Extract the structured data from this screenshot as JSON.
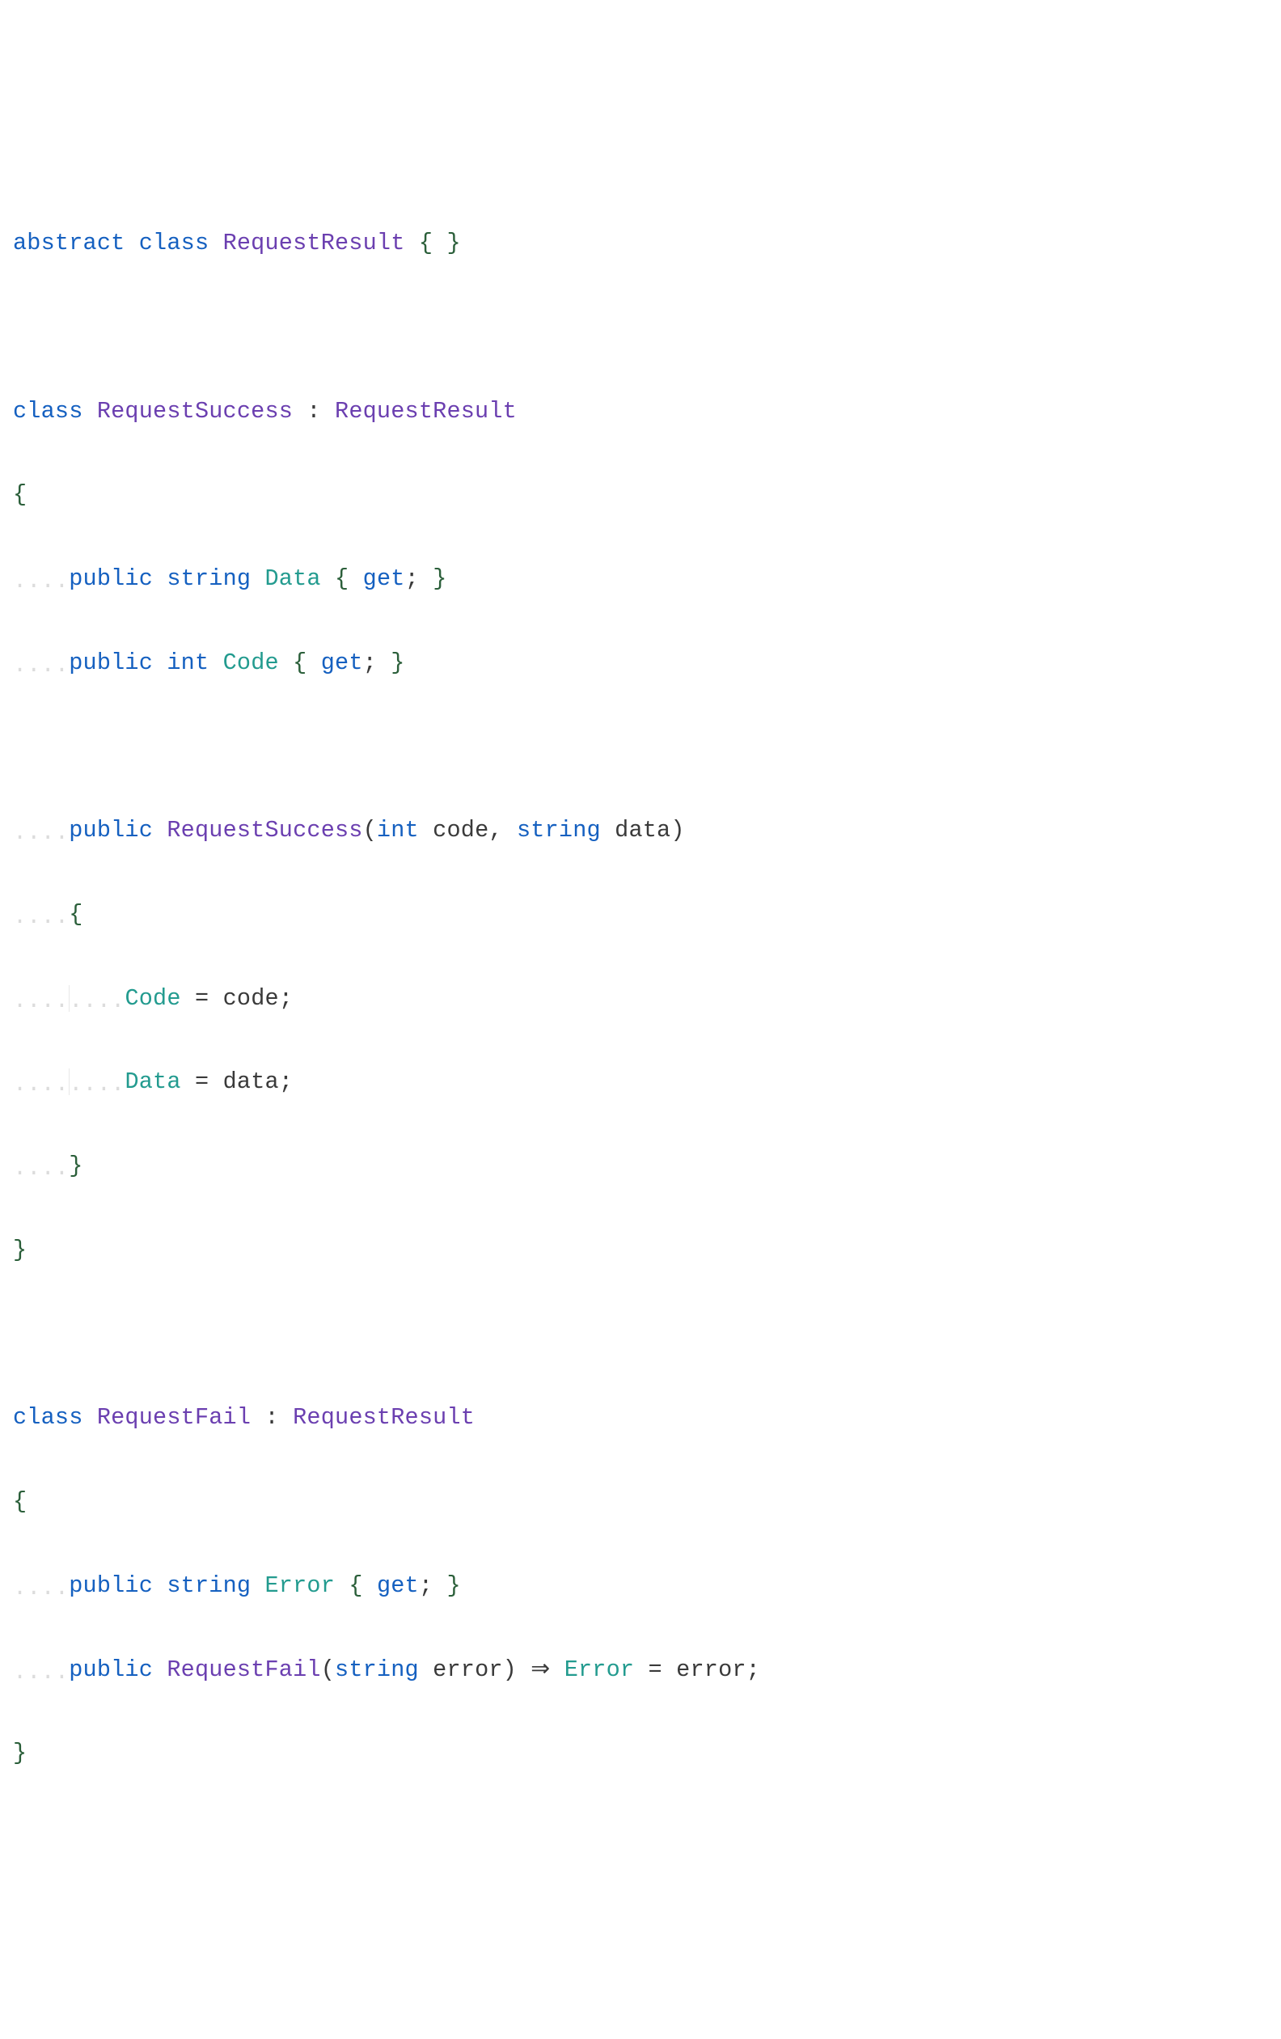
{
  "code": {
    "line01": {
      "abstract": "abstract",
      "class": "class",
      "name": "RequestResult",
      "open": "{",
      "close": "}"
    },
    "line03": {
      "class": "class",
      "name": "RequestSuccess",
      "colon": ":",
      "base": "RequestResult"
    },
    "line04": {
      "brace": "{"
    },
    "line05": {
      "public": "public",
      "type": "string",
      "prop": "Data",
      "open": "{",
      "get": "get",
      "semi": ";",
      "close": "}"
    },
    "line06": {
      "public": "public",
      "type": "int",
      "prop": "Code",
      "open": "{",
      "get": "get",
      "semi": ";",
      "close": "}"
    },
    "line08": {
      "public": "public",
      "name": "RequestSuccess",
      "lparen": "(",
      "t1": "int",
      "p1": "code",
      "comma": ",",
      "t2": "string",
      "p2": "data",
      "rparen": ")"
    },
    "line09": {
      "brace": "{"
    },
    "line10": {
      "lhs": "Code",
      "eq": "=",
      "rhs": "code",
      "semi": ";"
    },
    "line11": {
      "lhs": "Data",
      "eq": "=",
      "rhs": "data",
      "semi": ";"
    },
    "line12": {
      "brace": "}"
    },
    "line13": {
      "brace": "}"
    },
    "line15": {
      "class": "class",
      "name": "RequestFail",
      "colon": ":",
      "base": "RequestResult"
    },
    "line16": {
      "brace": "{"
    },
    "line17": {
      "public": "public",
      "type": "string",
      "prop": "Error",
      "open": "{",
      "get": "get",
      "semi": ";",
      "close": "}"
    },
    "line18": {
      "public": "public",
      "name": "RequestFail",
      "lparen": "(",
      "t1": "string",
      "p1": "error",
      "rparen": ")",
      "arrow": "⇒",
      "lhs": "Error",
      "eq": "=",
      "rhs": "error",
      "semi": ";"
    },
    "line19": {
      "brace": "}"
    }
  }
}
